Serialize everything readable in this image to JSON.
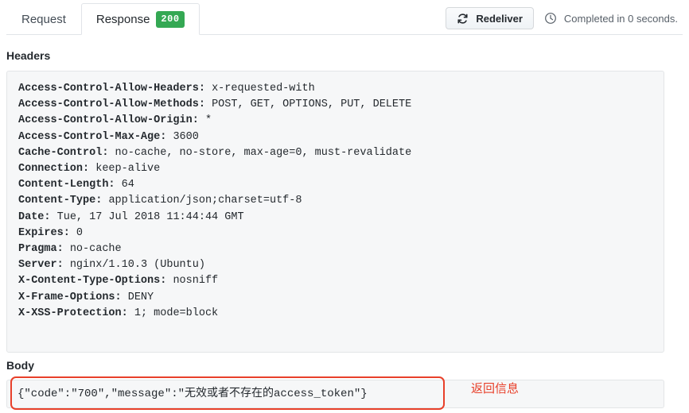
{
  "tabs": [
    {
      "label": "Request",
      "active": false,
      "badge": null
    },
    {
      "label": "Response",
      "active": true,
      "badge": "200"
    }
  ],
  "toolbar": {
    "redeliver_label": "Redeliver",
    "redeliver_icon": "sync-icon",
    "status_icon": "clock-icon",
    "status_text": "Completed in 0 seconds."
  },
  "sections": {
    "headers_title": "Headers",
    "body_title": "Body"
  },
  "headers": [
    {
      "name": "Access-Control-Allow-Headers:",
      "value": "x-requested-with"
    },
    {
      "name": "Access-Control-Allow-Methods:",
      "value": "POST, GET, OPTIONS, PUT, DELETE"
    },
    {
      "name": "Access-Control-Allow-Origin:",
      "value": "*"
    },
    {
      "name": "Access-Control-Max-Age:",
      "value": "3600"
    },
    {
      "name": "Cache-Control:",
      "value": "no-cache, no-store, max-age=0, must-revalidate"
    },
    {
      "name": "Connection:",
      "value": "keep-alive"
    },
    {
      "name": "Content-Length:",
      "value": "64"
    },
    {
      "name": "Content-Type:",
      "value": "application/json;charset=utf-8"
    },
    {
      "name": "Date:",
      "value": "Tue, 17 Jul 2018 11:44:44 GMT"
    },
    {
      "name": "Expires:",
      "value": "0"
    },
    {
      "name": "Pragma:",
      "value": "no-cache"
    },
    {
      "name": "Server:",
      "value": "nginx/1.10.3 (Ubuntu)"
    },
    {
      "name": "X-Content-Type-Options:",
      "value": "nosniff"
    },
    {
      "name": "X-Frame-Options:",
      "value": "DENY"
    },
    {
      "name": "X-XSS-Protection:",
      "value": "1; mode=block"
    }
  ],
  "body": {
    "content": "{\"code\":\"700\",\"message\":\"无效或者不存在的access_token\"}"
  },
  "annotation": {
    "text": "返回信息"
  },
  "colors": {
    "badge_green": "#34a853",
    "annotation_red": "#e8402a",
    "panel_bg": "#f6f7f8",
    "panel_border": "#e3e5e7",
    "text": "#24292e",
    "muted_text": "#586069"
  }
}
